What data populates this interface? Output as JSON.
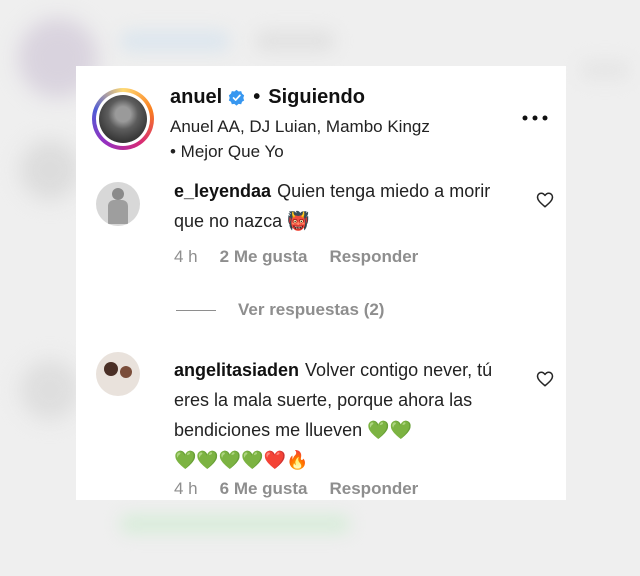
{
  "post": {
    "username": "anuel",
    "separator": "•",
    "follow_status": "Siguiendo",
    "song_line": "Anuel AA, DJ Luian, Mambo Kingz • Mejor Que Yo",
    "more_icon": "more-horizontal-icon",
    "verified_icon": "verified-badge-icon"
  },
  "comments": [
    {
      "username": "e_leyendaa",
      "text": "Quien tenga miedo a morir que no nazca",
      "emoji": "👹",
      "time": "4 h",
      "likes": "2 Me gusta",
      "reply_label": "Responder"
    },
    {
      "username": "angelitasiaden",
      "text": "Volver contigo never, tú eres la mala suerte, porque ahora las bendiciones me llueven",
      "hearts_line1": "💚💚",
      "hearts_line2": "💚💚💚💚❤️🔥",
      "time": "4 h",
      "likes": "6 Me gusta",
      "reply_label": "Responder"
    }
  ],
  "view_replies": "Ver respuestas (2)",
  "colors": {
    "verified": "#3797f0",
    "muted": "#8e8e8e",
    "text": "#262626"
  }
}
